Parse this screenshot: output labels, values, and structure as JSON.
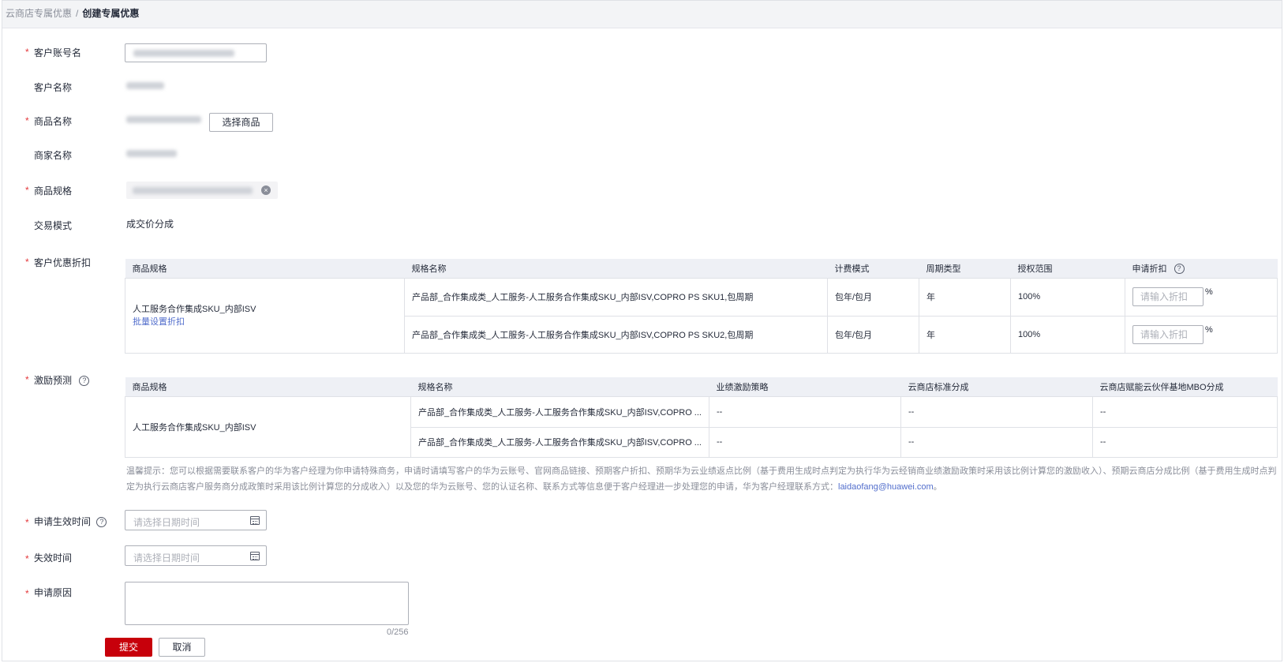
{
  "breadcrumb": {
    "parent": "云商店专属优惠",
    "separator": "/",
    "current": "创建专属优惠"
  },
  "form": {
    "account": {
      "label": "客户账号名",
      "required": "*"
    },
    "customer_name": {
      "label": "客户名称"
    },
    "product": {
      "label": "商品名称",
      "required": "*",
      "select_button": "选择商品"
    },
    "merchant": {
      "label": "商家名称"
    },
    "spec": {
      "label": "商品规格",
      "required": "*"
    },
    "trade_mode": {
      "label": "交易模式",
      "value": "成交价分成"
    },
    "discount": {
      "label": "客户优惠折扣",
      "required": "*"
    },
    "incentive": {
      "label": "激励预测",
      "required": "*"
    },
    "effective_time": {
      "label": "申请生效时间",
      "required": "*",
      "placeholder": "请选择日期时间"
    },
    "expire_time": {
      "label": "失效时间",
      "required": "*",
      "placeholder": "请选择日期时间"
    },
    "reason": {
      "label": "申请原因",
      "required": "*",
      "counter": "0/256"
    }
  },
  "discount_table": {
    "headers": [
      "商品规格",
      "规格名称",
      "计费模式",
      "周期类型",
      "授权范围",
      "申请折扣"
    ],
    "group": {
      "spec": "人工服务合作集成SKU_内部ISV",
      "batch_link": "批量设置折扣"
    },
    "rows": [
      {
        "name": "产品部_合作集成类_人工服务-人工服务合作集成SKU_内部ISV,COPRO PS SKU1,包周期",
        "billing": "包年/包月",
        "period": "年",
        "scope": "100%",
        "placeholder": "请输入折扣",
        "unit": "%"
      },
      {
        "name": "产品部_合作集成类_人工服务-人工服务合作集成SKU_内部ISV,COPRO PS SKU2,包周期",
        "billing": "包年/包月",
        "period": "年",
        "scope": "100%",
        "placeholder": "请输入折扣",
        "unit": "%"
      }
    ]
  },
  "incentive_table": {
    "headers": [
      "商品规格",
      "规格名称",
      "业绩激励策略",
      "云商店标准分成",
      "云商店赋能云伙伴基地MBO分成"
    ],
    "group": {
      "spec": "人工服务合作集成SKU_内部ISV"
    },
    "rows": [
      {
        "name": "产品部_合作集成类_人工服务-人工服务合作集成SKU_内部ISV,COPRO ...",
        "strategy": "--",
        "standard": "--",
        "mbo": "--"
      },
      {
        "name": "产品部_合作集成类_人工服务-人工服务合作集成SKU_内部ISV,COPRO ...",
        "strategy": "--",
        "standard": "--",
        "mbo": "--"
      }
    ]
  },
  "notice": {
    "text": "温馨提示：您可以根据需要联系客户的华为客户经理为你申请特殊商务，申请时请填写客户的华为云账号、官网商品链接、预期客户折扣、预期华为云业绩返点比例（基于费用生成时点判定为执行华为云经销商业绩激励政策时采用该比例计算您的激励收入）、预期云商店分成比例（基于费用生成时点判定为执行云商店客户服务商分成政策时采用该比例计算您的分成收入）以及您的华为云账号、您的认证名称、联系方式等信息便于客户经理进一步处理您的申请，华为客户经理联系方式：",
    "email": "laidaofang@huawei.com",
    "end": "。"
  },
  "actions": {
    "submit": "提交",
    "cancel": "取消"
  },
  "help_glyph": "?",
  "close_glyph": "×",
  "colors": {
    "primary": "#c7000b",
    "link": "#526ecc",
    "required": "#e4393c"
  }
}
